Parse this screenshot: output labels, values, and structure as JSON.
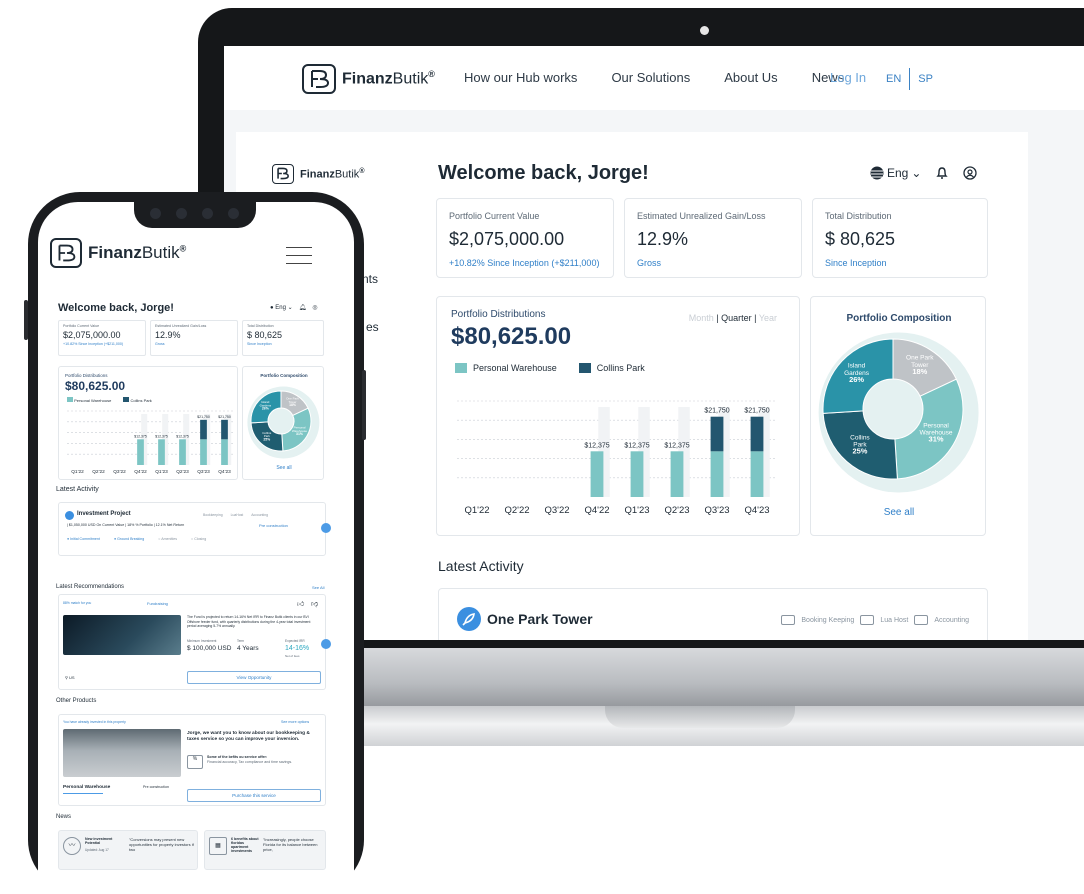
{
  "site": {
    "brand_bold": "Finanz",
    "brand_thin": "Butik",
    "brand_mark": "®",
    "nav": [
      "How our Hub works",
      "Our Solutions",
      "About Us",
      "News"
    ],
    "login": "Log In",
    "lang_en": "EN",
    "lang_sp": "SP"
  },
  "dashboard": {
    "brand_mark": "®",
    "sidebar_partial": [
      "nts",
      "es"
    ],
    "welcome": "Welcome back, Jorge!",
    "lang_selector": "Eng",
    "kpis": [
      {
        "label": "Portfolio Current Value",
        "value": "$2,075,000.00",
        "sub": "+10.82% Since Inception (+$211,000)"
      },
      {
        "label": "Estimated Unrealized Gain/Loss",
        "value": "12.9%",
        "sub": "Gross"
      },
      {
        "label": "Total Distribution",
        "value": "$ 80,625",
        "sub": "Since Inception"
      }
    ],
    "distributions": {
      "title": "Portfolio Distributions",
      "total": "$80,625.00",
      "period": {
        "month": "Month",
        "quarter": "Quarter",
        "year": "Year",
        "active": "Quarter"
      }
    },
    "composition": {
      "title": "Portfolio Composition",
      "see_all": "See all"
    },
    "latest_activity": "Latest Activity",
    "activity": {
      "title": "One Park Tower",
      "tags": [
        "Booking Keeping",
        "Lua Host",
        "Accounting"
      ]
    }
  },
  "chart_data": [
    {
      "type": "bar",
      "title": "Portfolio Distributions",
      "categories": [
        "Q1'22",
        "Q2'22",
        "Q3'22",
        "Q4'22",
        "Q1'23",
        "Q2'23",
        "Q3'23",
        "Q4'23"
      ],
      "series": [
        {
          "name": "Personal Warehouse",
          "color": "#7cc5c4",
          "values": [
            0,
            0,
            0,
            12375,
            12375,
            12375,
            12375,
            12375
          ]
        },
        {
          "name": "Collins Park",
          "color": "#23566f",
          "values": [
            0,
            0,
            0,
            0,
            0,
            0,
            9375,
            9375
          ]
        }
      ],
      "data_labels": [
        "",
        "",
        "",
        "$12,375",
        "$12,375",
        "$12,375",
        "$21,750",
        "$21,750"
      ],
      "stacked": true,
      "grid": true
    },
    {
      "type": "pie",
      "title": "Portfolio Composition",
      "slices": [
        {
          "label": "One Park Tower",
          "value": 18,
          "text": "18%",
          "color": "#bfc3c7"
        },
        {
          "label": "Personal Warehouse",
          "value": 31,
          "text": "31%",
          "color": "#7cc5c4"
        },
        {
          "label": "Collins Park",
          "value": 25,
          "text": "25%",
          "color": "#1f5d70"
        },
        {
          "label": "Island Gardens",
          "value": 26,
          "text": "26%",
          "color": "#2a93a8"
        }
      ]
    }
  ],
  "phone": {
    "welcome": "Welcome back, Jorge!",
    "lang_selector": "Eng",
    "kpis": [
      {
        "label": "Portfolio Current Value",
        "value": "$2,075,000.00",
        "sub": "+10.82% Since Inception (+$211,000)"
      },
      {
        "label": "Estimated Unrealized Gain/Loss",
        "value": "12.9%",
        "sub": "Gross"
      },
      {
        "label": "Total Distribution",
        "value": "$ 80,625",
        "sub": "Since Inception"
      }
    ],
    "distributions_title": "Portfolio Distributions",
    "distributions_total": "$80,625.00",
    "legend": [
      "Personal Warehouse",
      "Collins Park"
    ],
    "composition_title": "Portfolio Composition",
    "see_all": "See all",
    "latest_activity": "Latest Activity",
    "project": {
      "title": "Investment Project",
      "stats": "| $1,050,000 USD On Current Value  | 18% % Portfolio  | 12.1% Net Return",
      "status": "Pre construction",
      "steps": [
        "Initial Commitment",
        "Ground Breaking",
        "Amenities",
        "Closing"
      ],
      "tags": [
        "Bookkeeping",
        "LuaHost",
        "Accounting"
      ]
    },
    "recommendations": {
      "title": "Latest Recommendations",
      "see_all": "See All",
      "match": "88% match for you",
      "category": "Fundraising",
      "desc": "The Fund is projected to return 14-16% Net IRR to Finanz Butik clients in our BVI Offshore feeder fund, with quarterly distributions during the 4-year total investment period averaging 5-7% annually.",
      "min_label": "Minimum Investment",
      "min_value": "$ 100,000 USD",
      "term_label": "Term",
      "term_value": "4 Years",
      "irr_label": "Expected IRR",
      "irr_value": "14-16%",
      "irr_sub": "Net of fees",
      "location": "US",
      "cta": "View Opportunity"
    },
    "other": {
      "title": "Other Products",
      "note": "You have already invested in this property",
      "more": "See more options",
      "headline": "Jorge, we want you to know about our bookkeeping & taxes service so you can improve your inversion.",
      "benefits_title": "Some of the befits ou service offer:",
      "benefits": "Financial accuracy, Tax compliance and time savings.",
      "property": "Personal Warehouse",
      "status": "Pre construction",
      "cta": "Purchase this service"
    },
    "news": {
      "title": "News",
      "items": [
        {
          "title": "New investment Potential",
          "date": "Updated: Aug 17",
          "quote": "\"Conversions may present new opportunities for property investors if two"
        },
        {
          "title": "6 benefits about floridas apartment investments",
          "date": "",
          "quote": "\"Increasingly, people choose Florida for its balance between price,"
        }
      ]
    }
  }
}
